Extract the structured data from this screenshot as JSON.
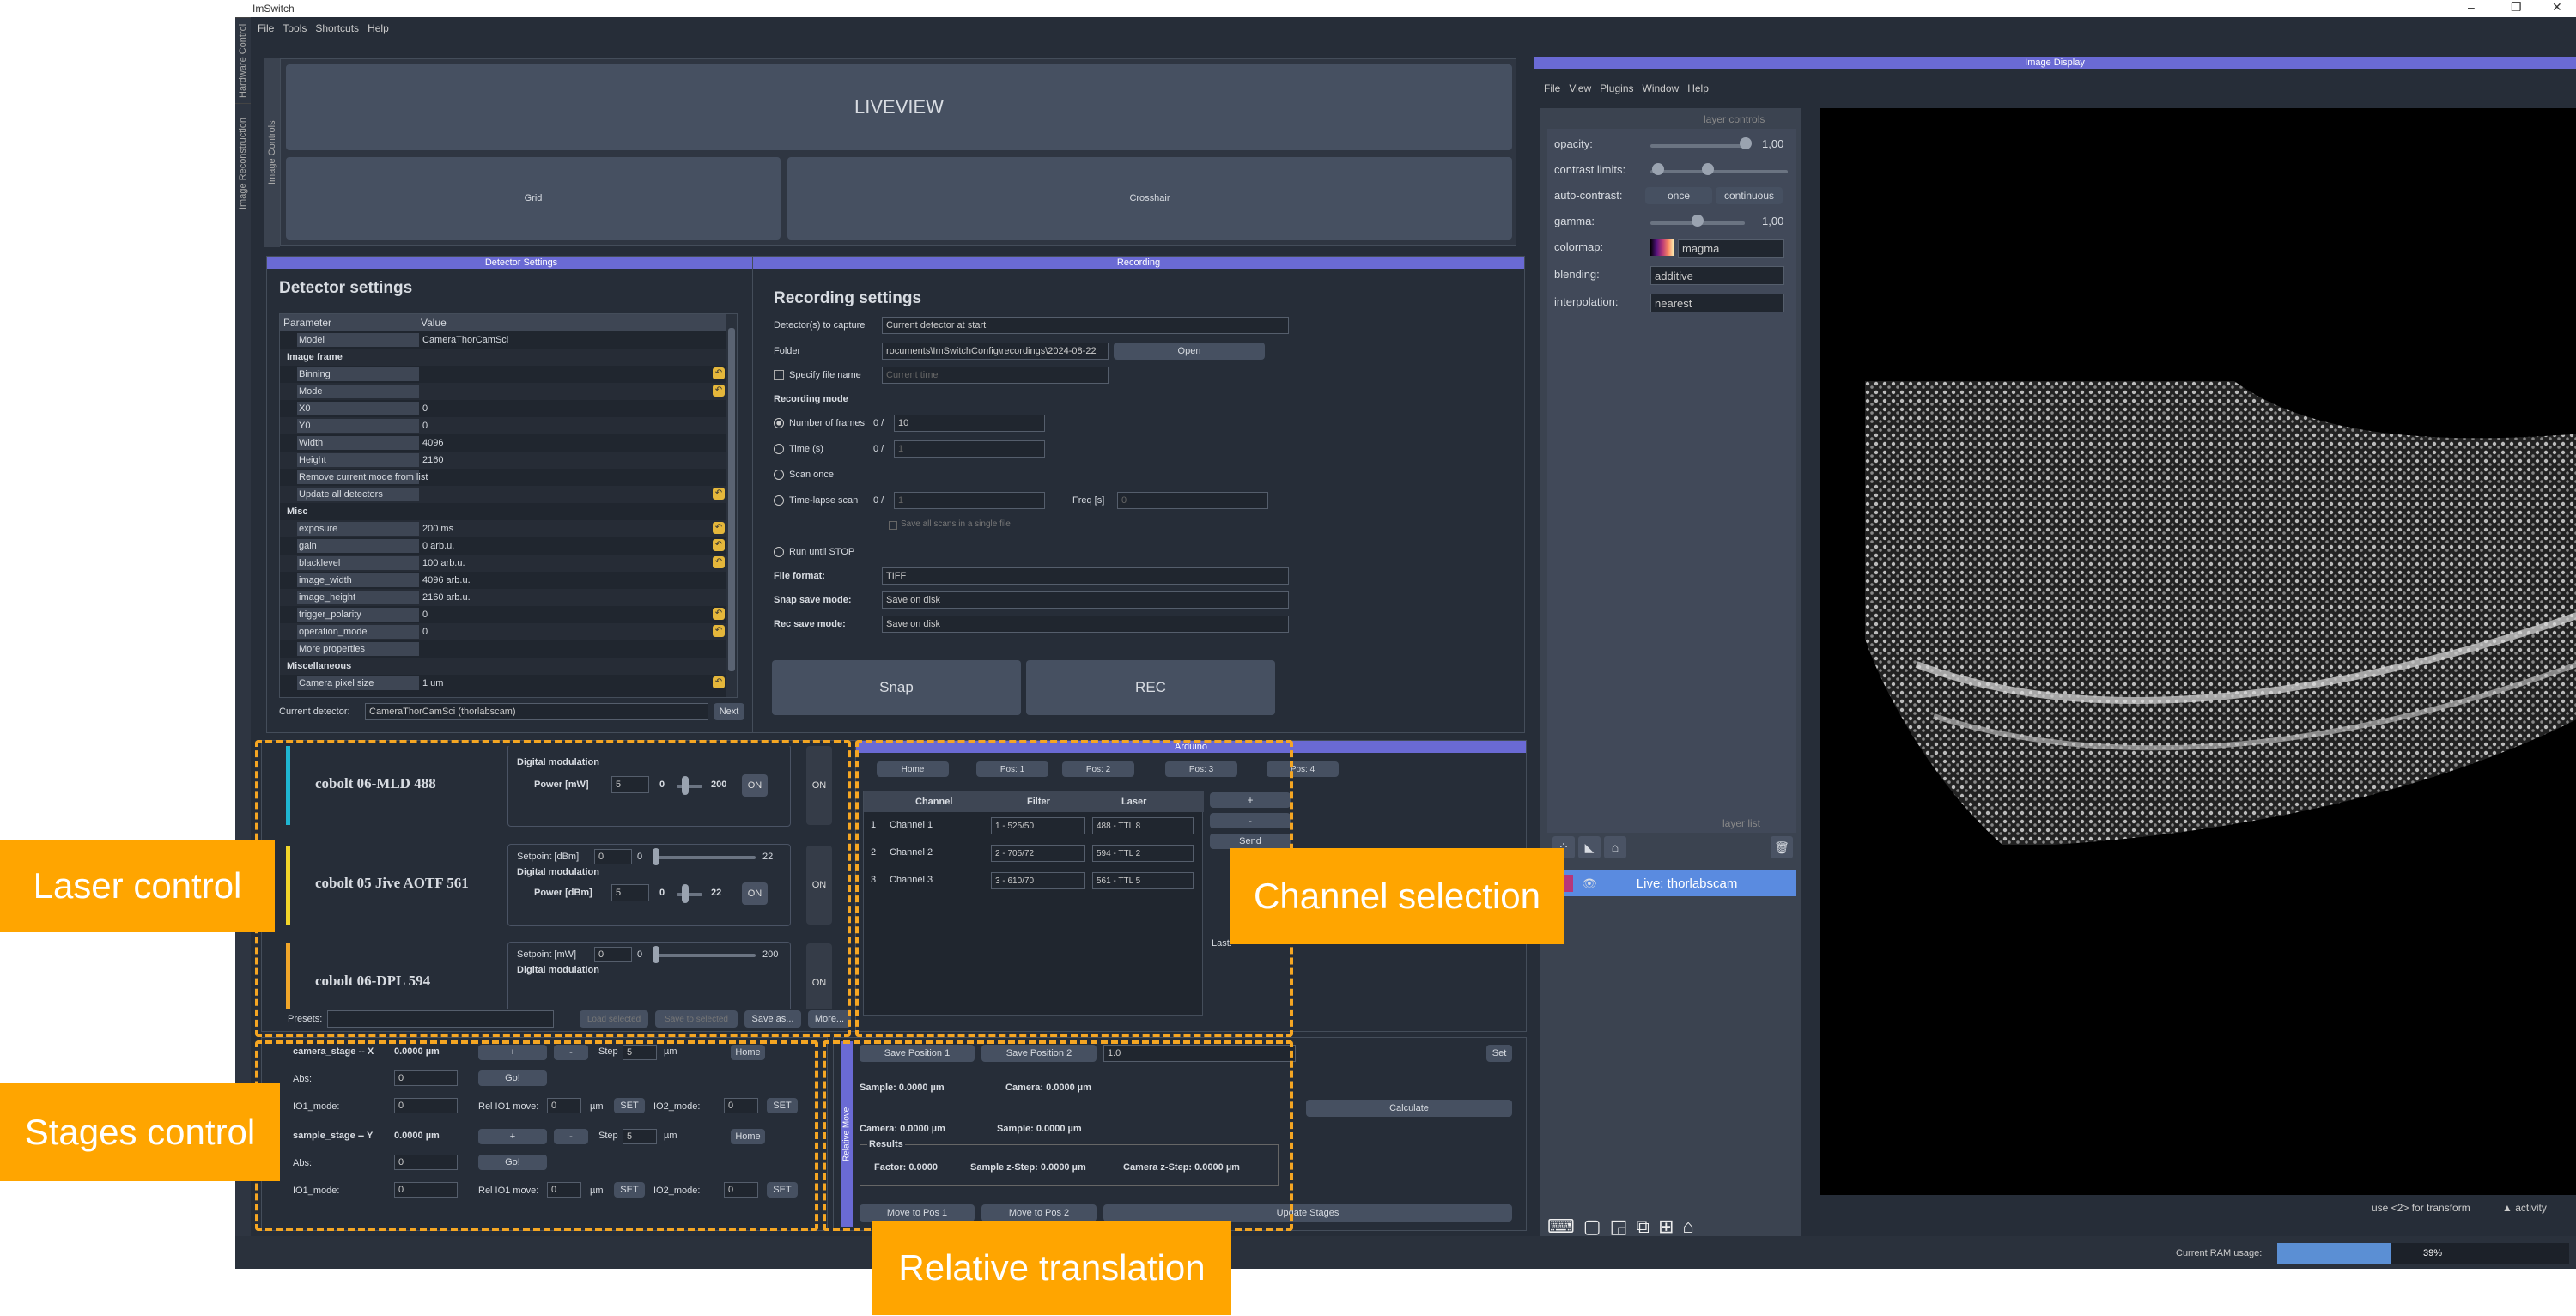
{
  "window": {
    "title": "ImSwitch",
    "controls": [
      "–",
      "❐",
      "✕"
    ]
  },
  "menu": [
    "File",
    "Tools",
    "Shortcuts",
    "Help"
  ],
  "side_tabs": [
    "Hardware Control",
    "Image Reconstruction"
  ],
  "image_controls_tab": "Image Controls",
  "liveview": {
    "title": "LIVEVIEW",
    "grid": "Grid",
    "crosshair": "Crosshair"
  },
  "detector": {
    "header": "Detector Settings",
    "title": "Detector settings",
    "col_param": "Parameter",
    "col_value": "Value",
    "rows": [
      {
        "name": "Model",
        "value": "CameraThorCamSci",
        "indent": 1
      },
      {
        "name": "Image frame",
        "value": "",
        "indent": 0,
        "group": true
      },
      {
        "name": "Binning",
        "value": "",
        "indent": 1
      },
      {
        "name": "Mode",
        "value": "",
        "indent": 1
      },
      {
        "name": "X0",
        "value": "0",
        "indent": 1
      },
      {
        "name": "Y0",
        "value": "0",
        "indent": 1
      },
      {
        "name": "Width",
        "value": "4096",
        "indent": 1
      },
      {
        "name": "Height",
        "value": "2160",
        "indent": 1
      },
      {
        "name": "Remove current mode from list",
        "value": "",
        "indent": 1
      },
      {
        "name": "Update all detectors",
        "value": "",
        "indent": 1
      },
      {
        "name": "Misc",
        "value": "",
        "indent": 0,
        "group": true
      },
      {
        "name": "exposure",
        "value": "200 ms",
        "indent": 1
      },
      {
        "name": "gain",
        "value": "0 arb.u.",
        "indent": 1
      },
      {
        "name": "blacklevel",
        "value": "100 arb.u.",
        "indent": 1
      },
      {
        "name": "image_width",
        "value": "4096 arb.u.",
        "indent": 1
      },
      {
        "name": "image_height",
        "value": "2160 arb.u.",
        "indent": 1
      },
      {
        "name": "trigger_polarity",
        "value": "0",
        "indent": 1
      },
      {
        "name": "operation_mode",
        "value": "0",
        "indent": 1
      },
      {
        "name": "More properties",
        "value": "",
        "indent": 1
      },
      {
        "name": "Miscellaneous",
        "value": "",
        "indent": 0,
        "group": true
      },
      {
        "name": "Camera pixel size",
        "value": "1 um",
        "indent": 1
      }
    ],
    "current_label": "Current detector:",
    "current_value": "CameraThorCamSci (thorlabscam)",
    "next": "Next"
  },
  "recording": {
    "header": "Recording",
    "title": "Recording settings",
    "capture_label": "Detector(s) to capture",
    "capture_value": "Current detector at start",
    "folder_label": "Folder",
    "folder_value": "rocuments\\ImSwitchConfig\\recordings\\2024-08-22",
    "open": "Open",
    "specify_label": "Specify file name",
    "specify_placeholder": "Current time",
    "mode_title": "Recording mode",
    "frames_label": "Number of frames",
    "frames_count": "0 /",
    "frames_value": "10",
    "time_label": "Time (s)",
    "time_count": "0 /",
    "time_value": "1",
    "scan_once": "Scan once",
    "timelapse_label": "Time-lapse scan",
    "timelapse_count": "0 /",
    "timelapse_value": "1",
    "freq_label": "Freq [s]",
    "freq_value": "0",
    "save_all": "Save all scans in a single file",
    "run_until": "Run until STOP",
    "format_label": "File format:",
    "format_value": "TIFF",
    "snap_mode_label": "Snap save mode:",
    "snap_mode_value": "Save on disk",
    "rec_mode_label": "Rec save mode:",
    "rec_mode_value": "Save on disk",
    "snap": "Snap",
    "rec": "REC"
  },
  "lasers": [
    {
      "name": "cobolt 06-MLD 488",
      "color": "#1fb5d1",
      "setpoint_label": "",
      "dm": "Digital modulation",
      "power_label": "Power [mW]",
      "power": "5",
      "min": "0",
      "max": "200",
      "on": "ON",
      "side": "ON"
    },
    {
      "name": "cobolt 05 Jive AOTF 561",
      "color": "#f1d52a",
      "setpoint_label": "Setpoint [dBm]",
      "sp_val": "0",
      "sp_min": "0",
      "sp_max": "22",
      "dm": "Digital modulation",
      "power_label": "Power [dBm]",
      "power": "5",
      "min": "0",
      "max": "22",
      "on": "ON",
      "side": "ON"
    },
    {
      "name": "cobolt 06-DPL 594",
      "color": "#f1a62a",
      "setpoint_label": "Setpoint [mW]",
      "sp_val": "0",
      "sp_min": "0",
      "sp_max": "200",
      "dm": "Digital modulation",
      "side": "ON"
    }
  ],
  "presets": {
    "label": "Presets:",
    "load": "Load selected",
    "save_to": "Save to selected",
    "save_as": "Save as...",
    "more": "More..."
  },
  "arduino": {
    "header": "Arduino",
    "positions": [
      "Home",
      "Pos: 1",
      "Pos: 2",
      "Pos: 3",
      "Pos: 4"
    ],
    "cols": [
      "Channel",
      "Filter",
      "Laser"
    ],
    "rows": [
      [
        "1",
        "Channel 1",
        "1 - 525/50",
        "488 - TTL 8"
      ],
      [
        "2",
        "Channel 2",
        "2 - 705/72",
        "594 - TTL 2"
      ],
      [
        "3",
        "Channel 3",
        "3 - 610/70",
        "561 - TTL 5"
      ]
    ],
    "plus": "+",
    "minus": "-",
    "send": "Send",
    "last": "Last:"
  },
  "stages": [
    {
      "name": "camera_stage -- X",
      "pos": "0.0000 µm",
      "plus": "+",
      "minus": "-",
      "step_label": "Step",
      "step": "5",
      "unit": "µm",
      "home": "Home",
      "abs": "Abs:",
      "abs_val": "0",
      "go": "Go!",
      "io1": "IO1_mode:",
      "io1_val": "0",
      "rel": "Rel IO1 move:",
      "rel_val": "0",
      "rel_unit": "µm",
      "set": "SET",
      "io2": "IO2_mode:",
      "io2_val": "0",
      "set2": "SET"
    },
    {
      "name": "sample_stage -- Y",
      "pos": "0.0000 µm",
      "plus": "+",
      "minus": "-",
      "step_label": "Step",
      "step": "5",
      "unit": "µm",
      "home": "Home",
      "abs": "Abs:",
      "abs_val": "0",
      "go": "Go!",
      "io1": "IO1_mode:",
      "io1_val": "0",
      "rel": "Rel IO1 move:",
      "rel_val": "0",
      "rel_unit": "µm",
      "set": "SET",
      "io2": "IO2_mode:",
      "io2_val": "0",
      "set2": "SET"
    }
  ],
  "relative": {
    "tab": "Relative Move",
    "save1": "Save Position 1",
    "save2": "Save Position 2",
    "val": "1.0",
    "set": "Set",
    "s1": "Sample: 0.0000 µm",
    "c1": "Camera: 0.0000 µm",
    "calc": "Calculate",
    "c2": "Camera: 0.0000 µm",
    "s2": "Sample: 0.0000 µm",
    "results": "Results",
    "factor": "Factor: 0.0000",
    "sz": "Sample z-Step: 0.0000 µm",
    "cz": "Camera z-Step: 0.0000 µm",
    "m1": "Move to Pos 1",
    "m2": "Move to Pos 2",
    "upd": "Update Stages"
  },
  "napari": {
    "header": "Image Display",
    "menu": [
      "File",
      "View",
      "Plugins",
      "Window",
      "Help"
    ],
    "layer_controls": "layer controls",
    "opacity_label": "opacity:",
    "opacity_val": "1,00",
    "contrast_label": "contrast limits:",
    "auto_label": "auto-contrast:",
    "once": "once",
    "continuous": "continuous",
    "gamma_label": "gamma:",
    "gamma_val": "1,00",
    "colormap_label": "colormap:",
    "colormap_val": "magma",
    "blending_label": "blending:",
    "blending_val": "additive",
    "interp_label": "interpolation:",
    "interp_val": "nearest",
    "layer_list": "layer list",
    "layer_name": "Live: thorlabscam",
    "scale": "500",
    "hint": "use <2> for transform",
    "activity": "▲ activity"
  },
  "status": {
    "ram_label": "Current RAM usage:",
    "ram_value": "39%",
    "ram_fraction": 0.39
  },
  "annotations": {
    "laser": "Laser control",
    "channel": "Channel selection",
    "stages": "Stages control",
    "relative": "Relative translation"
  }
}
